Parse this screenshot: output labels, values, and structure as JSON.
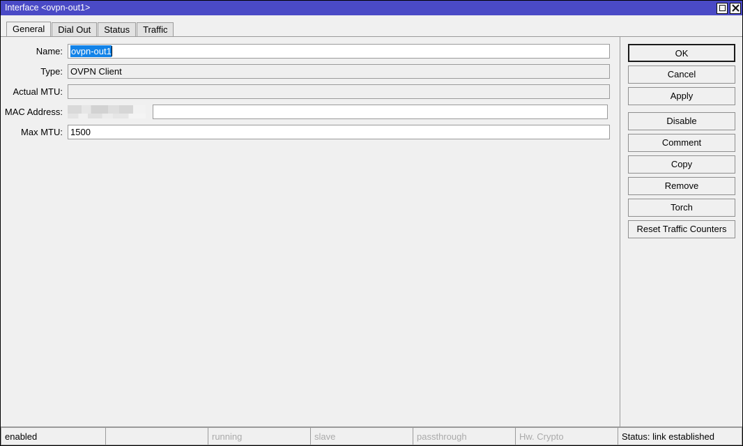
{
  "window": {
    "title": "Interface <ovpn-out1>",
    "controls": [
      {
        "name": "maximize-button",
        "icon": "square-icon"
      },
      {
        "name": "close-button",
        "icon": "close-icon"
      }
    ]
  },
  "tabs": [
    {
      "label": "General",
      "active": true
    },
    {
      "label": "Dial Out",
      "active": false
    },
    {
      "label": "Status",
      "active": false
    },
    {
      "label": "Traffic",
      "active": false
    }
  ],
  "form": {
    "fields": [
      {
        "label": "Name:",
        "value": "ovpn-out1",
        "type": "text-selected"
      },
      {
        "label": "Type:",
        "value": "OVPN Client",
        "type": "readonly"
      },
      {
        "label": "Actual MTU:",
        "value": "",
        "type": "readonly"
      },
      {
        "label": "MAC Address:",
        "value": "",
        "type": "redacted"
      },
      {
        "label": "Max MTU:",
        "value": "1500",
        "type": "text"
      }
    ]
  },
  "buttons": [
    {
      "label": "OK",
      "default": true
    },
    {
      "label": "Cancel",
      "default": false
    },
    {
      "label": "Apply",
      "default": false
    },
    {
      "label": "Disable",
      "default": false
    },
    {
      "label": "Comment",
      "default": false
    },
    {
      "label": "Copy",
      "default": false
    },
    {
      "label": "Remove",
      "default": false
    },
    {
      "label": "Torch",
      "default": false
    },
    {
      "label": "Reset Traffic Counters",
      "default": false
    }
  ],
  "statusbar": {
    "cells": [
      {
        "label": "enabled",
        "state": "on"
      },
      {
        "label": "",
        "state": "on"
      },
      {
        "label": "running",
        "state": "dim"
      },
      {
        "label": "slave",
        "state": "dim"
      },
      {
        "label": "passthrough",
        "state": "dim"
      },
      {
        "label": "Hw. Crypto",
        "state": "dim"
      }
    ],
    "status": "Status: link established"
  },
  "colors": {
    "titlebar": "#4a4ac6",
    "selection": "#1283e8",
    "face": "#f0f0f0",
    "border": "#9a9a9a",
    "disabled_text": "#aaaaaa"
  }
}
